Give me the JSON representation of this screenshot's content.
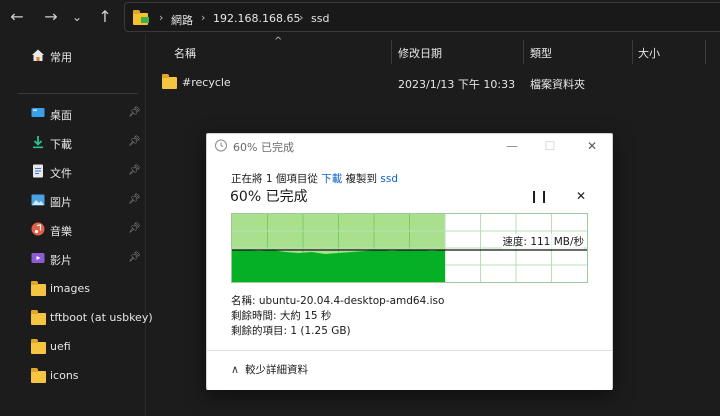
{
  "breadcrumb": [
    "網路",
    "192.168.168.65",
    "ssd"
  ],
  "sidebar": {
    "home": "常用",
    "items": [
      {
        "label": "桌面",
        "icon": "desktop-icon",
        "pinned": true
      },
      {
        "label": "下載",
        "icon": "download-icon",
        "pinned": true
      },
      {
        "label": "文件",
        "icon": "document-icon",
        "pinned": true
      },
      {
        "label": "圖片",
        "icon": "picture-icon",
        "pinned": true
      },
      {
        "label": "音樂",
        "icon": "music-icon",
        "pinned": true
      },
      {
        "label": "影片",
        "icon": "video-icon",
        "pinned": true
      },
      {
        "label": "images",
        "icon": "folder-icon",
        "pinned": false
      },
      {
        "label": "tftboot (at usbkey)",
        "icon": "folder-icon",
        "pinned": false
      },
      {
        "label": "uefi",
        "icon": "folder-icon",
        "pinned": false
      },
      {
        "label": "icons",
        "icon": "folder-icon",
        "pinned": false
      }
    ]
  },
  "columns": {
    "name": "名稱",
    "modified": "修改日期",
    "type": "類型",
    "size": "大小"
  },
  "files": [
    {
      "name": "#recycle",
      "modified": "2023/1/13 下午 10:33",
      "type": "檔案資料夾"
    }
  ],
  "dialog": {
    "title": "60% 已完成",
    "line1_prefix": "正在將 1 個項目從",
    "source": "下載",
    "line1_mid": "複製到",
    "dest": "ssd",
    "progress_text": "60% 已完成",
    "progress_value": 0.6,
    "speed": "速度: 111 MB/秒",
    "name_line": "名稱: ubuntu-20.04.4-desktop-amd64.iso",
    "time_line": "剩餘時間: 大約 15 秒",
    "items_line": "剩餘的項目: 1 (1.25 GB)",
    "details_toggle": "較少詳細資料",
    "pause_glyph": "❙❙",
    "close_glyph": "✕",
    "accent_green": "#06b025",
    "light_green": "#a8e08e"
  }
}
